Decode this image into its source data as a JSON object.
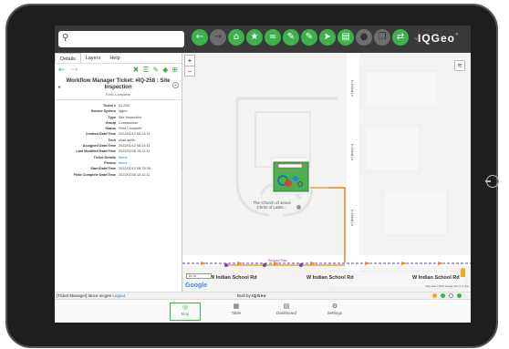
{
  "toolbar": {
    "search_placeholder": "",
    "icons": [
      "back-icon",
      "forward-icon",
      "home-icon",
      "star-icon",
      "link-icon",
      "edit-icon",
      "edit-icon-2",
      "send-icon",
      "print-icon",
      "user-icon",
      "copy-icon",
      "share-icon",
      "expand-icon"
    ],
    "logo": "IQGeo",
    "accent_color": "#3cb34a"
  },
  "tabs": [
    "Details",
    "Layers",
    "Help"
  ],
  "details": {
    "title": "Workflow Manager Ticket: #IQ-258 : Site Inspection",
    "subtitle": "Field Complete",
    "fields": [
      {
        "key": "Ticket #",
        "value": "IQ-258",
        "link": false
      },
      {
        "key": "Source System",
        "value": "Iqgeo",
        "link": false
      },
      {
        "key": "Type",
        "value": "Site Inspection",
        "link": false
      },
      {
        "key": "Group",
        "value": "Construction",
        "link": false
      },
      {
        "key": "Status",
        "value": "Field Complete",
        "link": false
      },
      {
        "key": "Created Date/Time",
        "value": "2022/01/12 08:24:11",
        "link": false
      },
      {
        "key": "Tech",
        "value": "chad.smith",
        "link": false
      },
      {
        "key": "Assigned Date/Time",
        "value": "2022/01/12 08:24:11",
        "link": false
      },
      {
        "key": "Last Modified Date/Time",
        "value": "2022/02/28 13:11:11",
        "link": false
      },
      {
        "key": "Ticket Details",
        "value": "Items",
        "link": true
      },
      {
        "key": "Photos",
        "value": "Items",
        "link": true
      },
      {
        "key": "Start Date/Time",
        "value": "2022/01/12 08:25:39",
        "link": false
      },
      {
        "key": "Field Complete Date/Time",
        "value": "2022/02/28 13:11:11",
        "link": false
      }
    ]
  },
  "map": {
    "roads": [
      "W Indian School Rd",
      "W Indian School Rd",
      "W Indian School Rd"
    ],
    "vertical_road": "N 192nd Ln",
    "church": "The Church of Jesus Christ of Latter...",
    "small_label": "Revised Plan",
    "scale": "61 m",
    "google": "Google",
    "map_data": "Map data ©2022 Google   Terms of Use",
    "zoom_in": "+",
    "zoom_out": "−"
  },
  "status": {
    "user_prefix": "[Ticket Manager] lance.mcgee",
    "logout": "Logout",
    "built_by": "Built by",
    "built_logo": "IQGeo"
  },
  "nav": [
    {
      "label": "Map",
      "icon": "map-pin-icon",
      "active": true
    },
    {
      "label": "Table",
      "icon": "table-icon",
      "active": false
    },
    {
      "label": "Dashboard",
      "icon": "dashboard-icon",
      "active": false
    },
    {
      "label": "Settings",
      "icon": "settings-icon",
      "active": false
    }
  ]
}
